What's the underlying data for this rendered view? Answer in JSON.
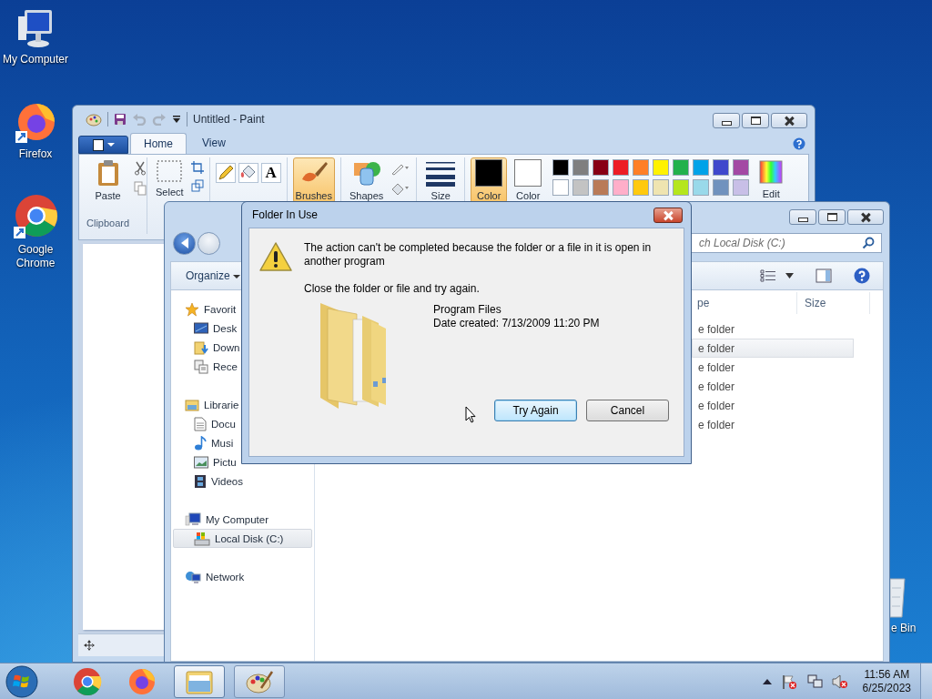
{
  "desktop_icons": [
    {
      "label": "My Computer"
    },
    {
      "label": "Firefox"
    },
    {
      "label": "Google Chrome"
    }
  ],
  "recycle_bin": {
    "label": "e Bin"
  },
  "paint": {
    "title": "Untitled - Paint",
    "tabs": [
      {
        "label": "Home",
        "selected": true
      },
      {
        "label": "View",
        "selected": false
      }
    ],
    "ribbon": {
      "paste": "Paste",
      "clipboard_group": "Clipboard",
      "select": "Select",
      "brushes": {
        "label": "Brushes",
        "selected": true
      },
      "text_tool": "A",
      "shapes": "Shapes",
      "size": "Size",
      "edit": "Edit"
    },
    "colors": [
      {
        "label": "Color",
        "color": "#000000",
        "selected": true
      },
      {
        "label": "Color",
        "color": "#ffffff",
        "selected": false
      }
    ],
    "palette": [
      {
        "color": "#000000"
      },
      {
        "color": "#7f7f7f"
      },
      {
        "color": "#880015"
      },
      {
        "color": "#ed1c24"
      },
      {
        "color": "#ff7f27"
      },
      {
        "color": "#fff200"
      },
      {
        "color": "#22b14c"
      },
      {
        "color": "#00a2e8"
      },
      {
        "color": "#3f48cc"
      },
      {
        "color": "#a349a4"
      },
      {
        "color": "#ffffff"
      },
      {
        "color": "#c3c3c3"
      },
      {
        "color": "#b97a57"
      },
      {
        "color": "#ffaec9"
      },
      {
        "color": "#ffc90e"
      },
      {
        "color": "#efe4b0"
      },
      {
        "color": "#b5e61d"
      },
      {
        "color": "#99d9ea"
      },
      {
        "color": "#7092be"
      },
      {
        "color": "#c8bfe7"
      }
    ]
  },
  "explorer": {
    "search": {
      "placeholder": "ch Local Disk (C:)"
    },
    "organize": "Organize",
    "nav": [
      {
        "label": "Favorit",
        "selected": false,
        "children": [
          {
            "label": "Desk",
            "selected": false
          },
          {
            "label": "Down",
            "selected": false
          },
          {
            "label": "Rece",
            "selected": false
          }
        ]
      },
      {
        "label": "Librarie",
        "selected": false,
        "children": [
          {
            "label": "Docu",
            "selected": false
          },
          {
            "label": "Musi",
            "selected": false
          },
          {
            "label": "Pictu",
            "selected": false
          },
          {
            "label": "Videos",
            "selected": false
          }
        ]
      },
      {
        "label": "My Computer",
        "selected": false,
        "children": [
          {
            "label": "Local Disk (C:)",
            "selected": true
          }
        ]
      },
      {
        "label": "Network",
        "selected": false
      }
    ],
    "columns": [
      "pe",
      "Size"
    ],
    "rows": [
      {
        "type": "e folder",
        "selected": false
      },
      {
        "type": "e folder",
        "selected": true
      },
      {
        "type": "e folder",
        "selected": false
      },
      {
        "type": "e folder",
        "selected": false
      },
      {
        "type": "e folder",
        "selected": false
      },
      {
        "type": "e folder",
        "selected": false
      }
    ]
  },
  "dialog": {
    "title": "Folder In Use",
    "message": "The action can't be completed because the folder or a file in it is open in another program",
    "instruction": "Close the folder or file and try again.",
    "item_name": "Program Files",
    "item_date": "Date created: 7/13/2009 11:20 PM",
    "buttons": [
      {
        "label": "Try Again",
        "default": true
      },
      {
        "label": "Cancel",
        "default": false
      }
    ]
  },
  "taskbar": {
    "apps": [
      {
        "kind": "chrome",
        "active": false
      },
      {
        "kind": "firefox",
        "active": false
      },
      {
        "kind": "explorer",
        "active": true
      },
      {
        "kind": "paint",
        "active": false
      }
    ],
    "time": "11:56 AM",
    "date": "6/25/2023"
  }
}
